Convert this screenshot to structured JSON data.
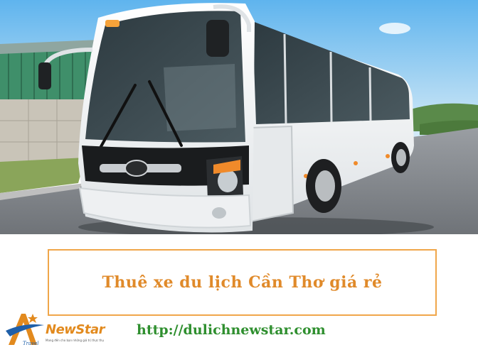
{
  "caption": {
    "title": "Thuê xe du lịch Cần Thơ giá rẻ"
  },
  "footer": {
    "url": "http://dulichnewstar.com"
  },
  "logo": {
    "brand": "NewStar",
    "sub": "Travel",
    "tagline": "Mang đến cho bạn những giá trị thực thụ"
  },
  "colors": {
    "caption_border": "#f0a64a",
    "caption_text": "#e08a2a",
    "url_text": "#2f8f2f",
    "brand_orange": "#e28a1e",
    "brand_blue": "#1f5fa8"
  }
}
